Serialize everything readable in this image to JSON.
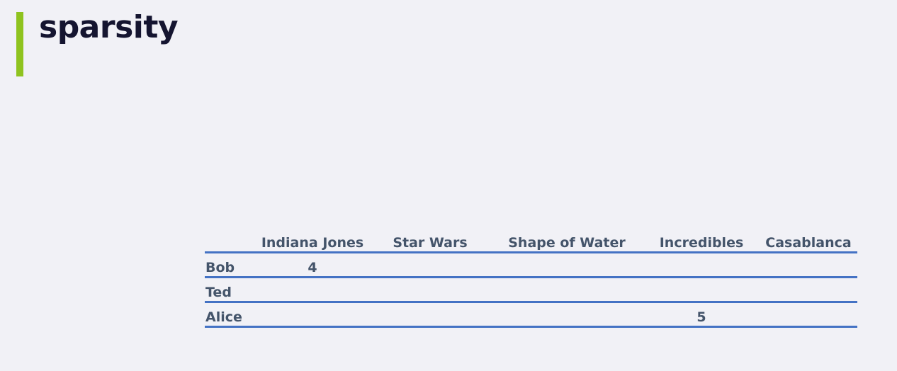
{
  "title": "sparsity",
  "table": {
    "columns": [
      "Indiana Jones",
      "Star Wars",
      "Shape of Water",
      "Incredibles",
      "Casablanca"
    ],
    "rows": [
      {
        "name": "Bob",
        "cells": [
          "4",
          "",
          "",
          "",
          ""
        ]
      },
      {
        "name": "Ted",
        "cells": [
          "",
          "",
          "",
          "",
          ""
        ]
      },
      {
        "name": "Alice",
        "cells": [
          "",
          "",
          "",
          "5",
          ""
        ]
      }
    ]
  },
  "colors": {
    "accent": "#8fc31f",
    "rule": "#4472c4",
    "table_text": "#44546a",
    "title_text": "#151530",
    "background": "#f1f1f6"
  }
}
